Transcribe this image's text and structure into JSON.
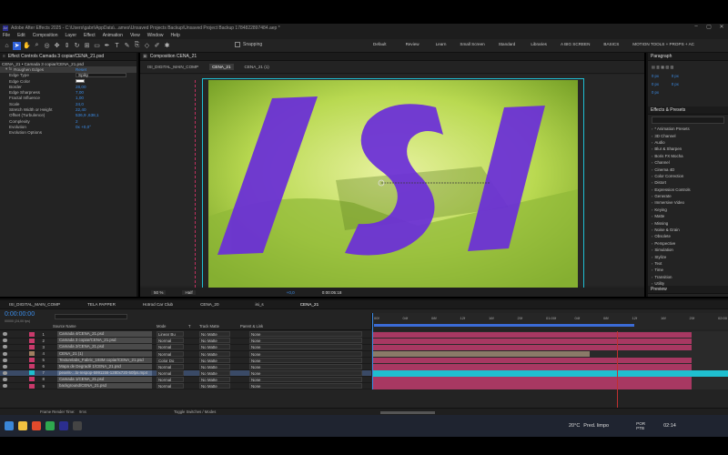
{
  "window": {
    "title": "Adobe After Effects 2025 - C:\\Users\\gabri\\AppData\\...ames\\Unsaved Projects Backup\\Unsaved Project Backup 1784822897484.aep *",
    "controls": [
      "–",
      "▢",
      "✕"
    ]
  },
  "menu": [
    "File",
    "Edit",
    "Composition",
    "Layer",
    "Effect",
    "Animation",
    "View",
    "Window",
    "Help"
  ],
  "toolbar": {
    "snapping_label": "Snapping",
    "workspaces": [
      "Default",
      "Review",
      "Learn",
      "Small Screen",
      "Standard",
      "Libraries",
      "A BIG SCREEN",
      "BASICS",
      "MOTION TOOLS + PROPS + AC"
    ]
  },
  "effect_controls": {
    "tab": "Effect Controls Camada 3 copiar/CENA_21.psd",
    "layer_path": "CENA_21 • Camada 3 copiar/CENA_21.psd",
    "effect_name": "Roughen Edges",
    "reset_label": "Reset",
    "rows": [
      {
        "label": "Edge Type",
        "value": "Spiky"
      },
      {
        "label": "Edge Color",
        "value": ""
      },
      {
        "label": "Border",
        "value": "28,00"
      },
      {
        "label": "Edge Sharpness",
        "value": "7,00"
      },
      {
        "label": "Fractal Influence",
        "value": "1,00"
      },
      {
        "label": "Scale",
        "value": "24,0"
      },
      {
        "label": "Stretch Width or Height",
        "value": "22,40"
      },
      {
        "label": "Offset (Turbulence)",
        "value": "536,9 ,638,1"
      },
      {
        "label": "Complexity",
        "value": "2"
      },
      {
        "label": "Evolution",
        "value": "0x +0,0°"
      },
      {
        "label": "Evolution Options",
        "value": ""
      }
    ]
  },
  "composition": {
    "tab": "Composition CENA_21",
    "breadcrumbs": [
      "ISI_DIGITAL_MAIN_COMP",
      "CENA_21",
      "CENA_21 (1)"
    ],
    "adaptive_label": "Adaptive Resolution (1/1)",
    "overlay_text": "ISI",
    "footer": {
      "zoom": "50 %",
      "quality": "Half",
      "exposure": "+0,0",
      "timecode": "0:00:05:18"
    }
  },
  "right_panel": {
    "paragraph_title": "Paragraph",
    "spacing_values": [
      "0 px",
      "0 px",
      "0 px",
      "0 px",
      "0 px"
    ],
    "effects_title": "Effects & Presets",
    "categories": [
      "* Animation Presets",
      "3D Channel",
      "Audio",
      "Blur & Sharpen",
      "Boris FX Mocha",
      "Channel",
      "Cinema 4D",
      "Color Correction",
      "Distort",
      "Expression Controls",
      "Generate",
      "Immersive Video",
      "Keying",
      "Matte",
      "Missing",
      "Noise & Grain",
      "Obsolete",
      "Perspective",
      "Simulation",
      "Stylize",
      "Text",
      "Time",
      "Transition",
      "Utility"
    ],
    "preview_label": "Preview"
  },
  "timeline": {
    "tabs": [
      "ISI_DIGITAL_MAIN_COMP",
      "TELA PAPPER",
      "Hotrod Car Club",
      "CENA_20",
      "isi_s",
      "CENA_21"
    ],
    "timecode": "0:00:00:00",
    "timecode_sub": "00000 (24,00 fps)",
    "headers": {
      "source_name": "Source Name",
      "mode": "Mode",
      "t": "T",
      "track_matte": "Track Matte",
      "parent": "Parent & Link"
    },
    "ruler": [
      "00f",
      "04f",
      "08f",
      "12f",
      "16f",
      "20f",
      "01:00f",
      "04f",
      "08f",
      "12f",
      "16f",
      "20f",
      "02:00"
    ],
    "layers": [
      {
        "idx": "1",
        "name": "Camada 4/CENA_21.psd",
        "mode": "Linear Bu",
        "matte": "No Matte",
        "parent": "None"
      },
      {
        "idx": "2",
        "name": "Camada 3 copiar/CENA_21.psd",
        "mode": "Normal",
        "matte": "No Matte",
        "parent": "None"
      },
      {
        "idx": "3",
        "name": "Camada 2/CENA_21.psd",
        "mode": "Normal",
        "matte": "No Matte",
        "parent": "None"
      },
      {
        "idx": "4",
        "name": "CENA_21 (1)",
        "mode": "Normal",
        "matte": "No Matte",
        "parent": "None"
      },
      {
        "idx": "5",
        "name": "Texturelabs_Fabric_193M copiar/CENA_21.psd",
        "mode": "Color Do",
        "matte": "No Matte",
        "parent": "None"
      },
      {
        "idx": "6",
        "name": "Mapa de Degradê 1/CENA_21.psd",
        "mode": "Normal",
        "matte": "No Matte",
        "parent": "None"
      },
      {
        "idx": "7",
        "name": "pexels-...lo-respop-5991156-1280x720-50fps.mp4",
        "mode": "Normal",
        "matte": "No Matte",
        "parent": "None"
      },
      {
        "idx": "8",
        "name": "Camada 1/CENA_21.psd",
        "mode": "Normal",
        "matte": "No Matte",
        "parent": "None"
      },
      {
        "idx": "9",
        "name": "background/CENA_21.psd",
        "mode": "Normal",
        "matte": "No Matte",
        "parent": "None"
      }
    ],
    "render_time_label": "Frame Render Time:",
    "render_time_value": "9ms",
    "toggle_label": "Toggle Switches / Modes"
  },
  "taskbar": {
    "weather": "20°C",
    "forecast": "Pred. limpo",
    "language": "POR",
    "region": "PTB",
    "time": "02:14"
  }
}
